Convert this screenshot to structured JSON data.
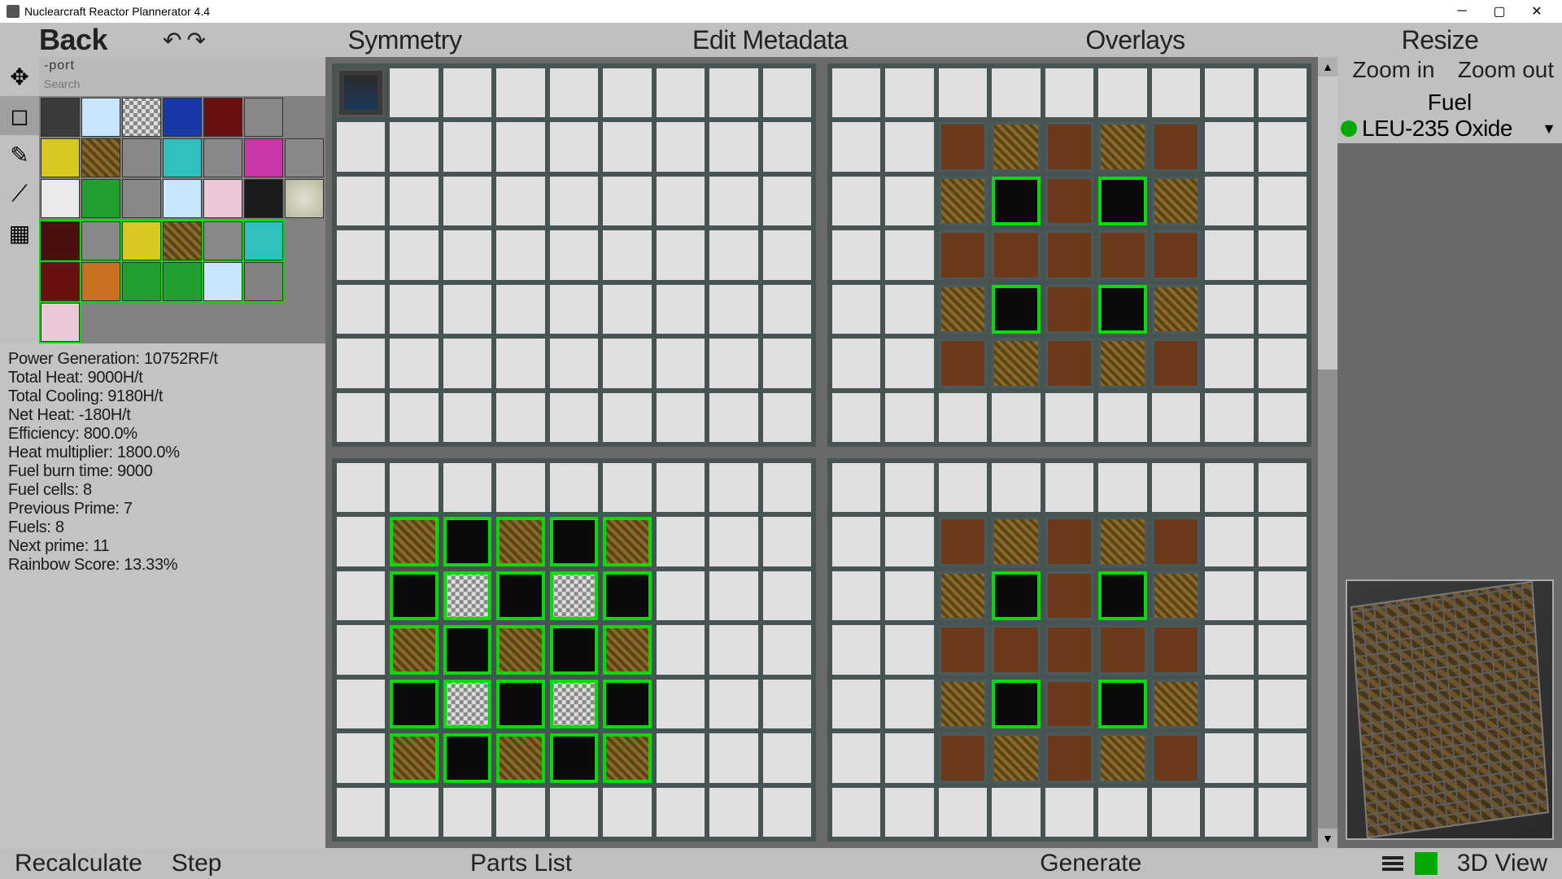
{
  "title": "Nuclearcraft Reactor Plannerator 4.4",
  "menubar": {
    "back": "Back",
    "symmetry": "Symmetry",
    "edit_metadata": "Edit Metadata",
    "overlays": "Overlays",
    "resize": "Resize"
  },
  "search": {
    "label": "-port",
    "placeholder": "Search"
  },
  "tools": [
    "move",
    "block",
    "pencil",
    "line",
    "grid"
  ],
  "stats": {
    "power_gen": "Power Generation: 10752RF/t",
    "total_heat": "Total Heat: 9000H/t",
    "total_cool": "Total Cooling: 9180H/t",
    "net_heat": "Net Heat: -180H/t",
    "efficiency": "Efficiency: 800.0%",
    "heat_mult": "Heat multiplier: 1800.0%",
    "fuel_burn": "Fuel burn time: 9000",
    "fuel_cells": "Fuel cells: 8",
    "prev_prime": "Previous Prime: 7",
    "fuels": "Fuels: 8",
    "next_prime": "Next prime: 11",
    "rainbow": "Rainbow Score: 13.33%"
  },
  "zoom": {
    "in": "Zoom in",
    "out": "Zoom out"
  },
  "fuel": {
    "label": "Fuel",
    "selected": "LEU-235 Oxide"
  },
  "bottombar": {
    "recalc": "Recalculate",
    "step": "Step",
    "parts": "Parts List",
    "generate": "Generate",
    "view3d": "3D View"
  },
  "layers": {
    "grid_size": {
      "cols": 9,
      "rows": 7
    },
    "l1": "all casing, port at [0,0]",
    "l2": {
      "rows": [
        "c c c c c c c c c",
        "c b m b m b c c c",
        "c m f b f m c c c",
        "c b b b b b c c c",
        "c m f b f m c c c",
        "c b m b m b c c c",
        "c c c c c c c c c"
      ]
    },
    "l3": {
      "rows": [
        "c c c c c c c c c",
        "c M F M F M c c c",
        "c F D F D F c c c",
        "c M F M F M c c c",
        "c F D F D F c c c",
        "c M F M F M c c c",
        "c c c c c c c c c"
      ]
    },
    "l4": {
      "rows": [
        "c c c c c c c c c",
        "c b m b m b c c c",
        "c m f b f m c c c",
        "c b b b b b c c c",
        "c m f b f m c c c",
        "c b m b m b c c c",
        "c c c c c c c c c"
      ]
    }
  }
}
